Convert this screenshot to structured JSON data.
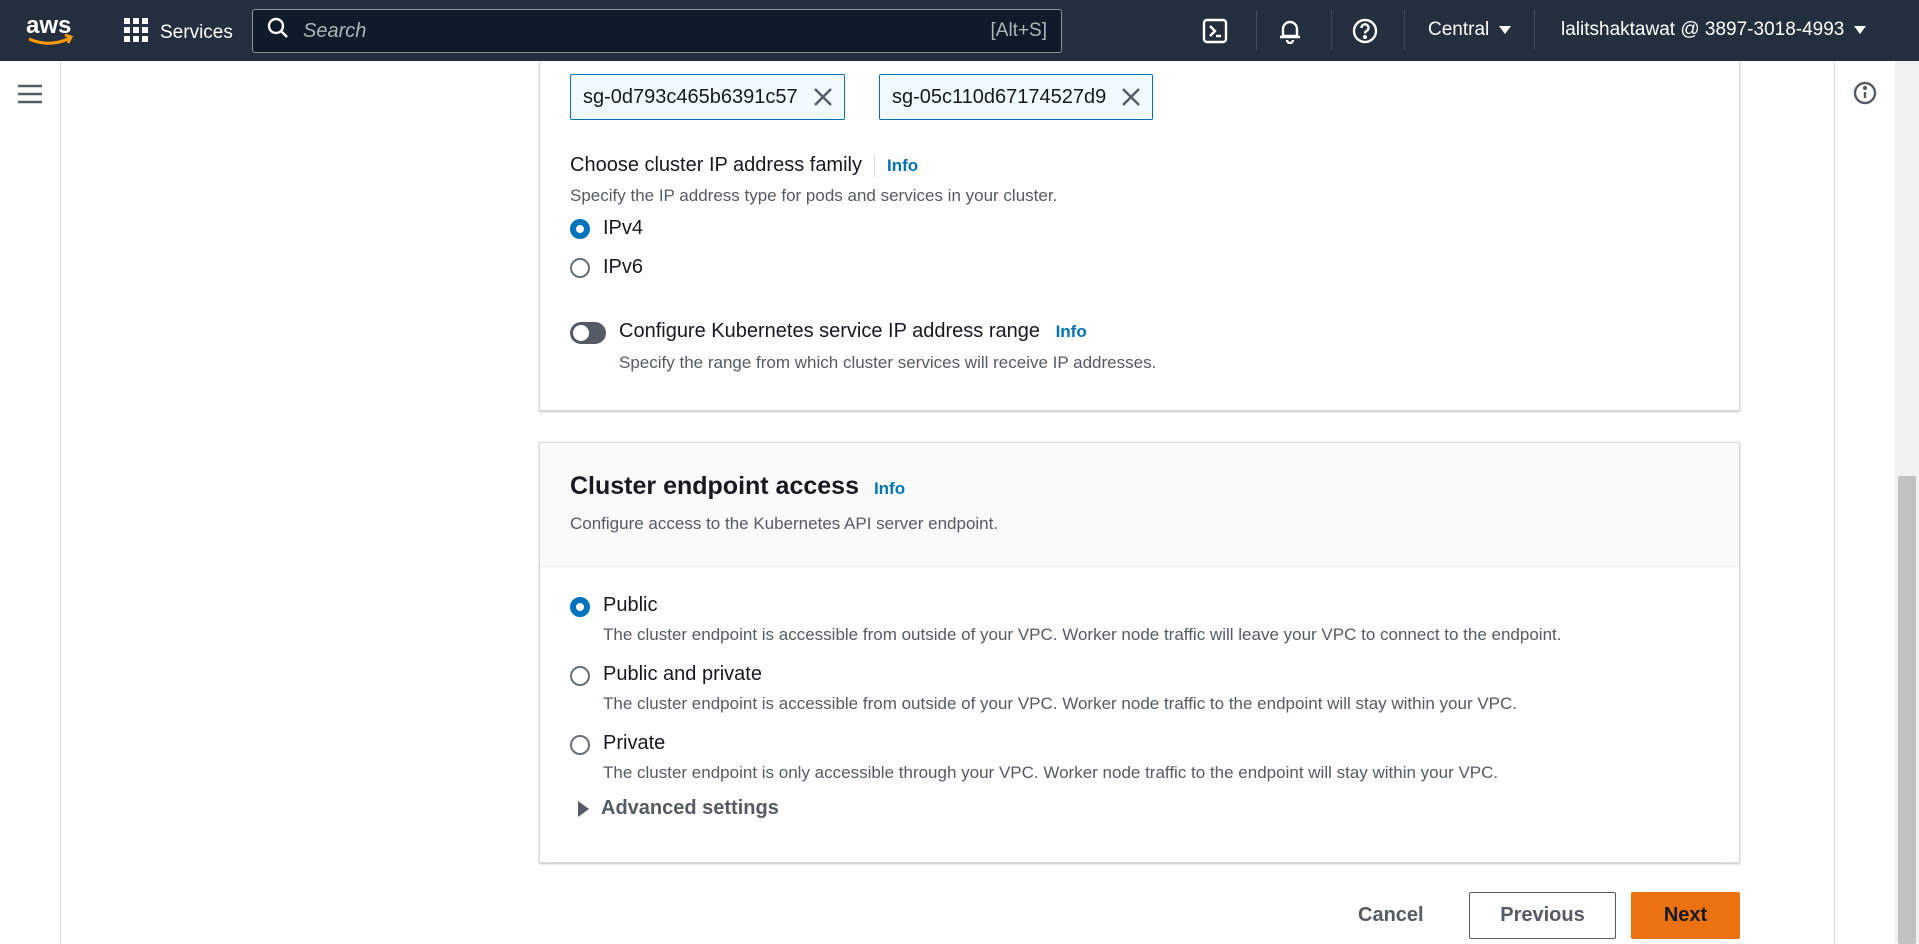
{
  "topnav": {
    "logo_text": "aws",
    "services_label": "Services",
    "search_placeholder": "Search",
    "search_shortcut": "[Alt+S]",
    "region": "Central",
    "account": "lalitshaktawat @ 3897-3018-4993"
  },
  "security_groups": {
    "tokens": [
      "sg-0d793c465b6391c57",
      "sg-05c110d67174527d9"
    ]
  },
  "ip_family": {
    "label": "Choose cluster IP address family",
    "info": "Info",
    "description": "Specify the IP address type for pods and services in your cluster.",
    "options": [
      "IPv4",
      "IPv6"
    ],
    "selected": "IPv4"
  },
  "service_ip_range": {
    "label": "Configure Kubernetes service IP address range",
    "info": "Info",
    "description": "Specify the range from which cluster services will receive IP addresses.",
    "enabled": false
  },
  "endpoint_access": {
    "title": "Cluster endpoint access",
    "info": "Info",
    "description": "Configure access to the Kubernetes API server endpoint.",
    "selected": "Public",
    "options": [
      {
        "label": "Public",
        "description": "The cluster endpoint is accessible from outside of your VPC. Worker node traffic will leave your VPC to connect to the endpoint."
      },
      {
        "label": "Public and private",
        "description": "The cluster endpoint is accessible from outside of your VPC. Worker node traffic to the endpoint will stay within your VPC."
      },
      {
        "label": "Private",
        "description": "The cluster endpoint is only accessible through your VPC. Worker node traffic to the endpoint will stay within your VPC."
      }
    ],
    "advanced_settings": "Advanced settings"
  },
  "footer": {
    "cancel": "Cancel",
    "previous": "Previous",
    "next": "Next"
  },
  "colors": {
    "nav_bg": "#232f3e",
    "link": "#0073bb",
    "primary_button": "#ec7211",
    "aws_smile": "#ff9900"
  }
}
